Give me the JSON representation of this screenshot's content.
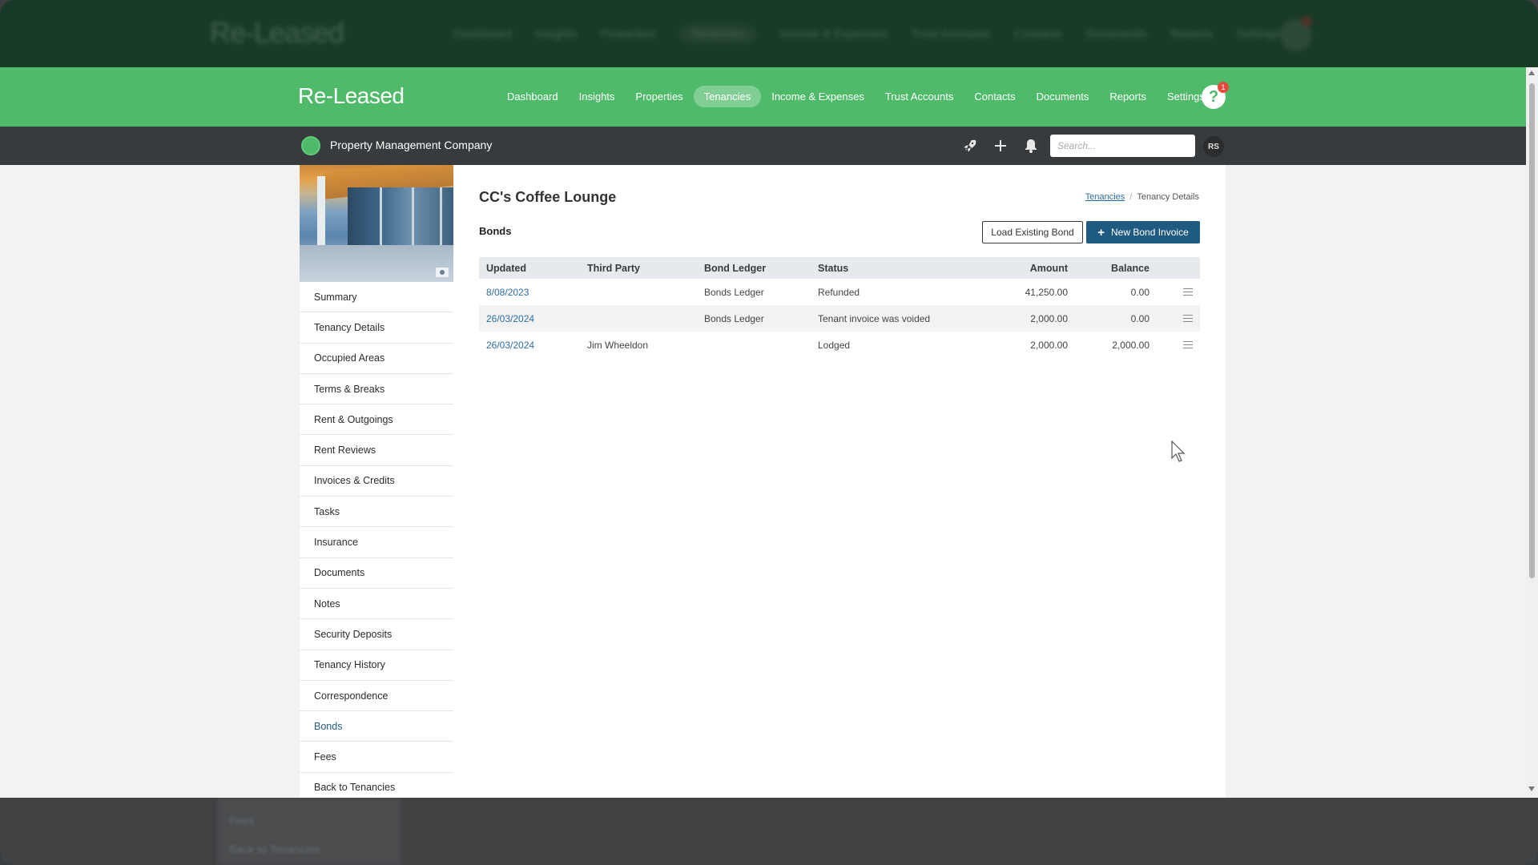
{
  "app": {
    "logo": "Re-Leased",
    "nav": [
      {
        "label": "Dashboard",
        "active": false
      },
      {
        "label": "Insights",
        "active": false
      },
      {
        "label": "Properties",
        "active": false
      },
      {
        "label": "Tenancies",
        "active": true
      },
      {
        "label": "Income & Expenses",
        "active": false
      },
      {
        "label": "Trust Accounts",
        "active": false
      },
      {
        "label": "Contacts",
        "active": false
      },
      {
        "label": "Documents",
        "active": false
      },
      {
        "label": "Reports",
        "active": false
      },
      {
        "label": "Settings",
        "active": false
      }
    ],
    "help_glyph": "?",
    "help_badge": "1",
    "accent_color": "#4fbb6a",
    "primary_color": "#1f5a80"
  },
  "subbar": {
    "org_name": "Property Management Company",
    "search_placeholder": "Search...",
    "avatar_initials": "RS",
    "icons": [
      "rocket-icon",
      "plus-icon",
      "bell-icon"
    ]
  },
  "sidebar": {
    "items": [
      {
        "label": "Summary",
        "active": false
      },
      {
        "label": "Tenancy Details",
        "active": false
      },
      {
        "label": "Occupied Areas",
        "active": false
      },
      {
        "label": "Terms & Breaks",
        "active": false
      },
      {
        "label": "Rent & Outgoings",
        "active": false
      },
      {
        "label": "Rent Reviews",
        "active": false
      },
      {
        "label": "Invoices & Credits",
        "active": false
      },
      {
        "label": "Tasks",
        "active": false
      },
      {
        "label": "Insurance",
        "active": false
      },
      {
        "label": "Documents",
        "active": false
      },
      {
        "label": "Notes",
        "active": false
      },
      {
        "label": "Security Deposits",
        "active": false
      },
      {
        "label": "Tenancy History",
        "active": false
      },
      {
        "label": "Correspondence",
        "active": false
      },
      {
        "label": "Bonds",
        "active": true
      },
      {
        "label": "Fees",
        "active": false
      },
      {
        "label": "Back to Tenancies",
        "active": false
      }
    ]
  },
  "content": {
    "title": "CC's Coffee Lounge",
    "breadcrumb": {
      "link": "Tenancies",
      "separator": "/",
      "current": "Tenancy Details"
    },
    "section": "Bonds",
    "load_button": "Load Existing Bond",
    "new_button": "New Bond Invoice",
    "table": {
      "columns": [
        "Updated",
        "Third Party",
        "Bond Ledger",
        "Status",
        "Amount",
        "Balance"
      ],
      "rows": [
        {
          "updated": "8/08/2023",
          "third_party": "",
          "ledger": "Bonds Ledger",
          "status": "Refunded",
          "amount": "41,250.00",
          "balance": "0.00"
        },
        {
          "updated": "26/03/2024",
          "third_party": "",
          "ledger": "Bonds Ledger",
          "status": "Tenant invoice was voided",
          "amount": "2,000.00",
          "balance": "0.00"
        },
        {
          "updated": "26/03/2024",
          "third_party": "Jim Wheeldon",
          "ledger": "",
          "status": "Lodged",
          "amount": "2,000.00",
          "balance": "2,000.00"
        }
      ]
    }
  },
  "ghost": {
    "logo": "Re-Leased",
    "nav": [
      "Dashboard",
      "Insights",
      "Properties",
      "Tenancies",
      "Income & Expenses",
      "Trust Accounts",
      "Contacts",
      "Documents",
      "Reports",
      "Settings"
    ],
    "bottom_items": [
      "Fees",
      "Back to Tenancies"
    ]
  }
}
